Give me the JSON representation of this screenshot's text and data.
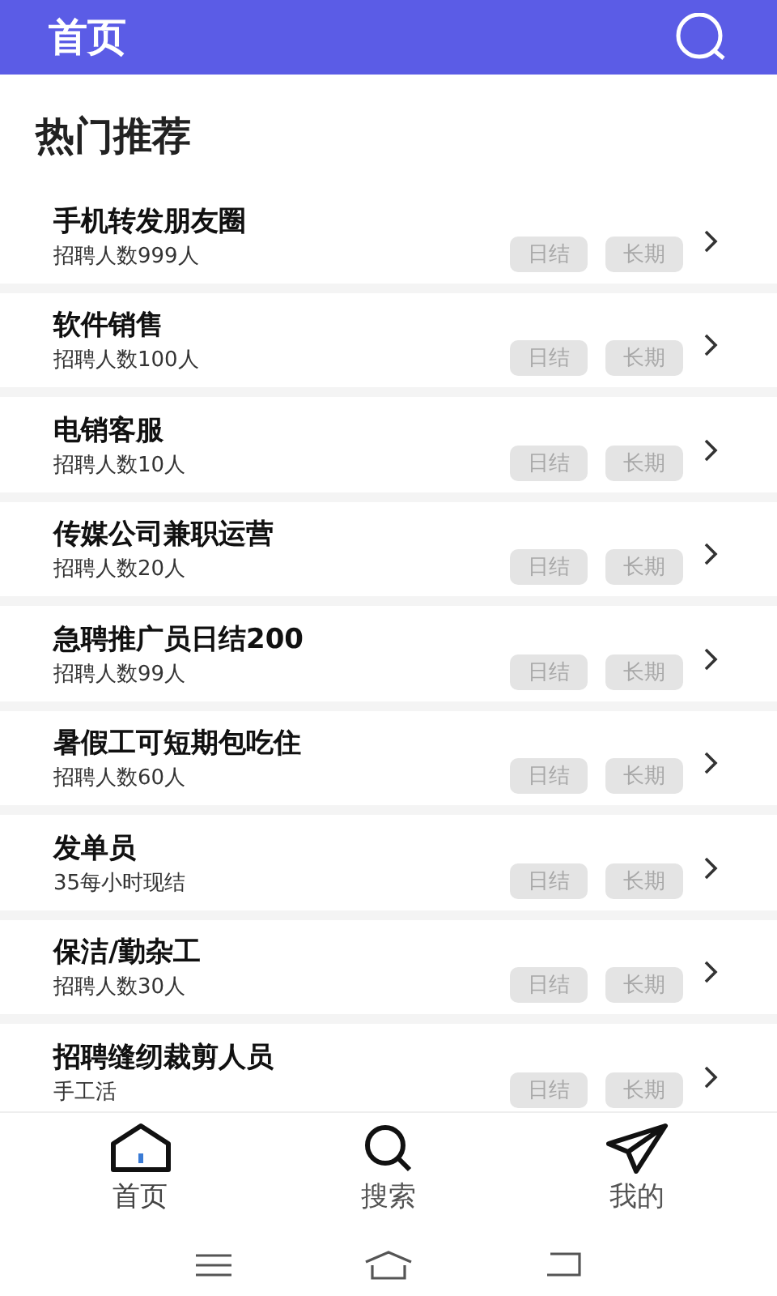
{
  "header": {
    "title": "首页"
  },
  "section_title": "热门推荐",
  "jobs": [
    {
      "title": "手机转发朋友圈",
      "subtitle": "招聘人数999人",
      "tags": [
        "日结",
        "长期"
      ]
    },
    {
      "title": "软件销售",
      "subtitle": "招聘人数100人",
      "tags": [
        "日结",
        "长期"
      ]
    },
    {
      "title": "电销客服",
      "subtitle": "招聘人数10人",
      "tags": [
        "日结",
        "长期"
      ]
    },
    {
      "title": "传媒公司兼职运营",
      "subtitle": "招聘人数20人",
      "tags": [
        "日结",
        "长期"
      ]
    },
    {
      "title": "急聘推广员日结200",
      "subtitle": "招聘人数99人",
      "tags": [
        "日结",
        "长期"
      ]
    },
    {
      "title": "暑假工可短期包吃住",
      "subtitle": "招聘人数60人",
      "tags": [
        "日结",
        "长期"
      ]
    },
    {
      "title": "发单员",
      "subtitle": "35每小时现结",
      "tags": [
        "日结",
        "长期"
      ]
    },
    {
      "title": "保洁/勤杂工",
      "subtitle": "招聘人数30人",
      "tags": [
        "日结",
        "长期"
      ]
    },
    {
      "title": "招聘缝纫裁剪人员",
      "subtitle": "手工活",
      "tags": [
        "日结",
        "长期"
      ]
    }
  ],
  "tabs": [
    {
      "label": "首页",
      "kind": "home",
      "selected": true
    },
    {
      "label": "搜索",
      "kind": "search",
      "selected": false
    },
    {
      "label": "我的",
      "kind": "send",
      "selected": false
    }
  ]
}
